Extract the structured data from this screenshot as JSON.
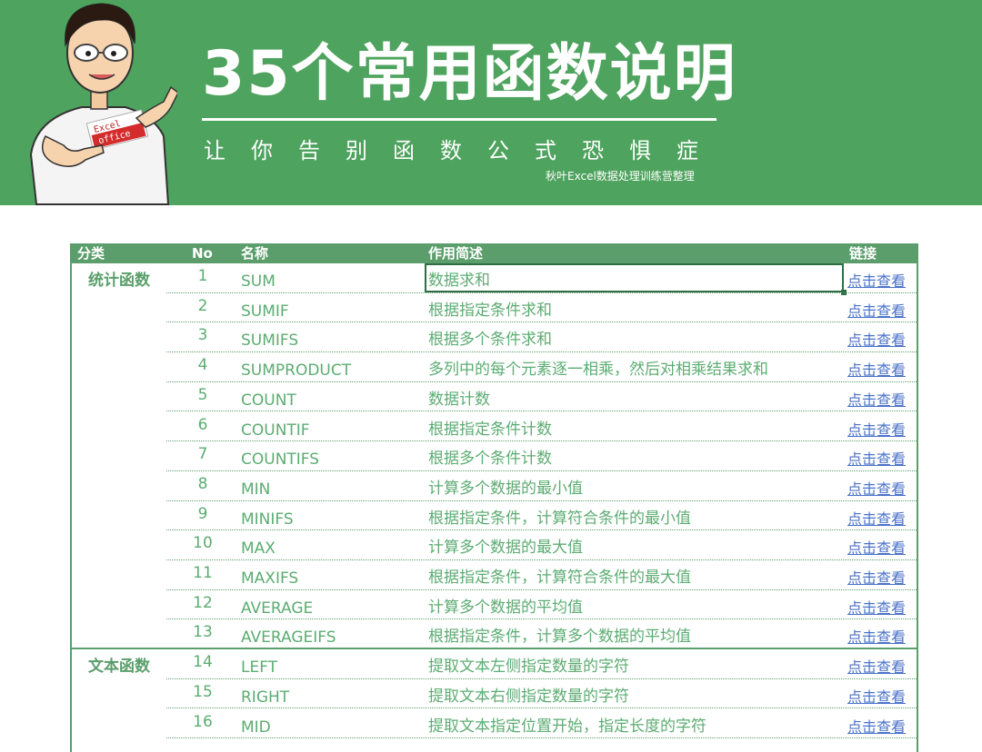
{
  "header": {
    "title": "35个常用函数说明",
    "subtitle": "让你告别函数公式恐惧症",
    "credit": "秋叶Excel数据处理训练营整理",
    "mascot_shirt_lines": [
      "Excel",
      "office"
    ],
    "colors": {
      "banner": "#4ea35e",
      "table_accent": "#5b9e6b",
      "link": "#4a72c8"
    }
  },
  "table": {
    "columns": {
      "category": "分类",
      "no": "No",
      "name": "名称",
      "desc": "作用简述",
      "link": "链接"
    },
    "rows": [
      {
        "category": "统计函数",
        "no": "1",
        "name": "SUM",
        "desc": "数据求和",
        "link": "点击查看"
      },
      {
        "category": "",
        "no": "2",
        "name": "SUMIF",
        "desc": "根据指定条件求和",
        "link": "点击查看"
      },
      {
        "category": "",
        "no": "3",
        "name": "SUMIFS",
        "desc": "根据多个条件求和",
        "link": "点击查看"
      },
      {
        "category": "",
        "no": "4",
        "name": "SUMPRODUCT",
        "desc": "多列中的每个元素逐一相乘，然后对相乘结果求和",
        "link": "点击查看"
      },
      {
        "category": "",
        "no": "5",
        "name": "COUNT",
        "desc": "数据计数",
        "link": "点击查看"
      },
      {
        "category": "",
        "no": "6",
        "name": "COUNTIF",
        "desc": "根据指定条件计数",
        "link": "点击查看"
      },
      {
        "category": "",
        "no": "7",
        "name": "COUNTIFS",
        "desc": "根据多个条件计数",
        "link": "点击查看"
      },
      {
        "category": "",
        "no": "8",
        "name": "MIN",
        "desc": "计算多个数据的最小值",
        "link": "点击查看"
      },
      {
        "category": "",
        "no": "9",
        "name": "MINIFS",
        "desc": "根据指定条件，计算符合条件的最小值",
        "link": "点击查看"
      },
      {
        "category": "",
        "no": "10",
        "name": "MAX",
        "desc": "计算多个数据的最大值",
        "link": "点击查看"
      },
      {
        "category": "",
        "no": "11",
        "name": "MAXIFS",
        "desc": "根据指定条件，计算符合条件的最大值",
        "link": "点击查看"
      },
      {
        "category": "",
        "no": "12",
        "name": "AVERAGE",
        "desc": "计算多个数据的平均值",
        "link": "点击查看"
      },
      {
        "category": "",
        "no": "13",
        "name": "AVERAGEIFS",
        "desc": "根据指定条件，计算多个数据的平均值",
        "link": "点击查看"
      },
      {
        "category": "文本函数",
        "no": "14",
        "name": "LEFT",
        "desc": "提取文本左侧指定数量的字符",
        "link": "点击查看"
      },
      {
        "category": "",
        "no": "15",
        "name": "RIGHT",
        "desc": "提取文本右侧指定数量的字符",
        "link": "点击查看"
      },
      {
        "category": "",
        "no": "16",
        "name": "MID",
        "desc": "提取文本指定位置开始，指定长度的字符",
        "link": "点击查看"
      }
    ]
  }
}
